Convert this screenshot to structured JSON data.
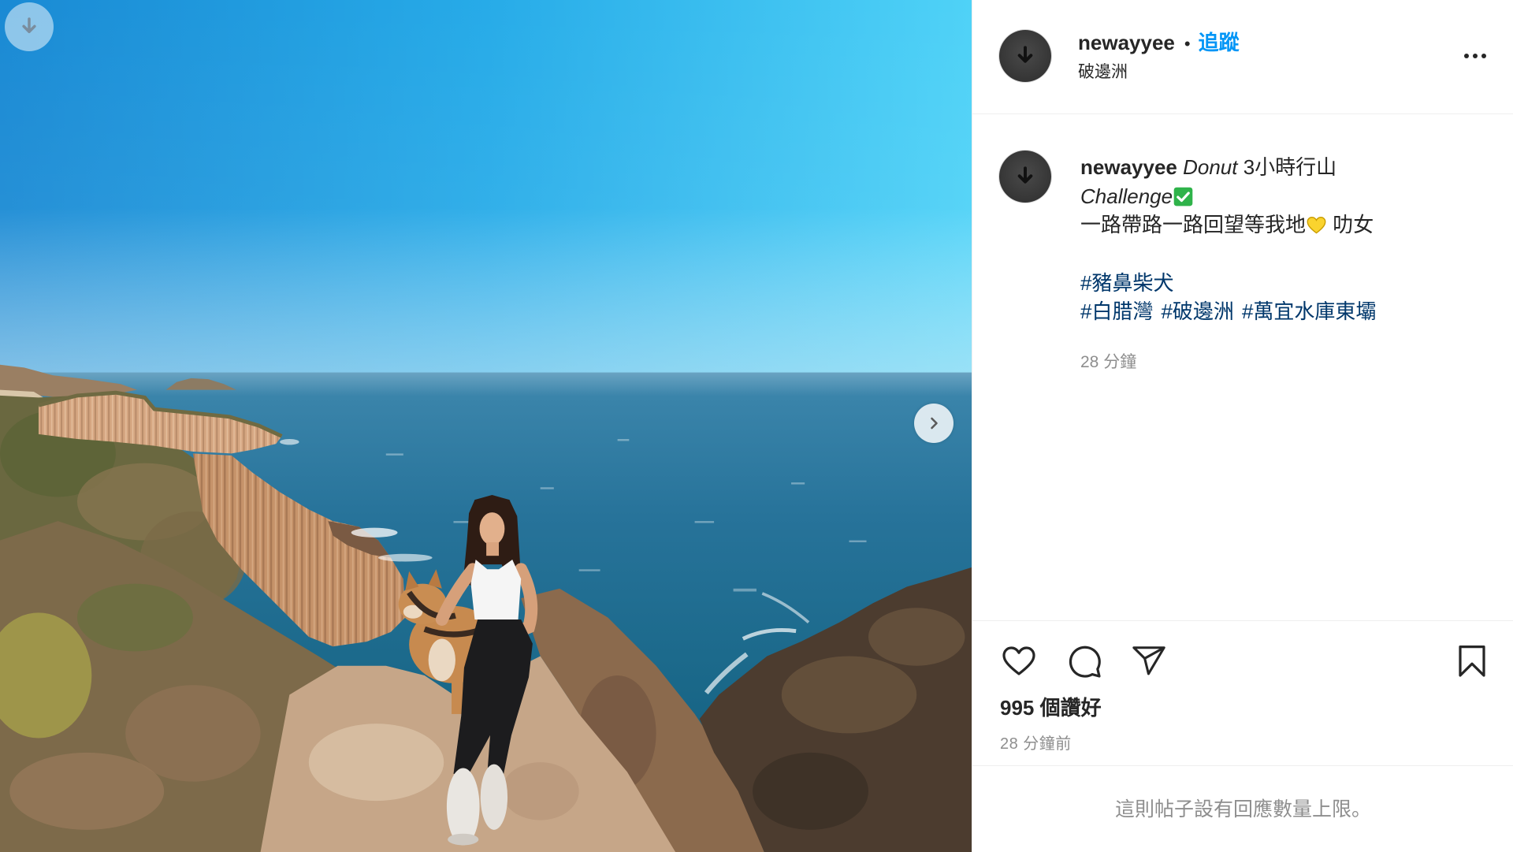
{
  "post_media": {
    "download_icon": "download-icon",
    "next_icon": "chevron-right-icon"
  },
  "header": {
    "avatar_icon": "download-icon",
    "username": "newayyee",
    "separator": "•",
    "follow_label": "追蹤",
    "location": "破邊洲",
    "more_icon": "more-options-icon"
  },
  "caption": {
    "avatar_icon": "download-icon",
    "username": "newayyee",
    "line1_italic": "Donut",
    "line1_text": " 3小時行山",
    "line2_italic": "Challenge",
    "line2_icon": "check-mark-button-icon",
    "line3_text": "一路帶路一路回望等我地",
    "line3_icon": "yellow-heart-icon",
    "line3_suffix": " 叻女",
    "hashtags": [
      "#豬鼻柴犬",
      "#白腊灣",
      "#破邊洲",
      "#萬宜水庫東壩"
    ],
    "time": "28 分鐘"
  },
  "actions": {
    "like_icon": "heart-icon",
    "comment_icon": "comment-icon",
    "share_icon": "share-icon",
    "save_icon": "bookmark-icon",
    "likes": "995 個讚好",
    "timestamp": "28 分鐘前"
  },
  "comments": {
    "limit_notice": "這則帖子設有回應數量上限。"
  },
  "colors": {
    "text": "#262626",
    "muted": "#8e8e8e",
    "follow": "#0095f6",
    "hashtag": "#00376b",
    "border": "#efefef"
  }
}
